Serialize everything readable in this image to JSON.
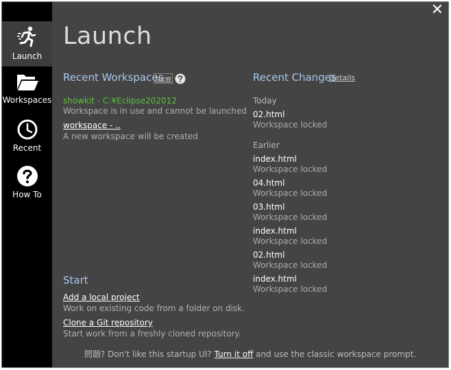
{
  "window": {
    "title": "Launch"
  },
  "sidebar": {
    "items": [
      {
        "label": "Launch",
        "icon": "running-person-icon"
      },
      {
        "label": "Workspaces",
        "icon": "folder-open-icon"
      },
      {
        "label": "Recent",
        "icon": "clock-icon"
      },
      {
        "label": "How To",
        "icon": "question-circle-icon"
      }
    ]
  },
  "recent_workspaces": {
    "heading": "Recent Workspaces",
    "new_label": "New",
    "items": [
      {
        "name": "showkit - C:¥Eclipse202012",
        "desc": "Workspace is in use and cannot be launched"
      },
      {
        "name": "workspace - ..",
        "desc": "A new workspace will be created"
      }
    ]
  },
  "recent_changes": {
    "heading": "Recent Changes",
    "details_label": "Details",
    "today_label": "Today",
    "earlier_label": "Earlier",
    "today": [
      {
        "file": "02.html",
        "status": "Workspace locked"
      }
    ],
    "earlier": [
      {
        "file": "index.html",
        "status": "Workspace locked"
      },
      {
        "file": "04.html",
        "status": "Workspace locked"
      },
      {
        "file": "03.html",
        "status": "Workspace locked"
      },
      {
        "file": "index.html",
        "status": "Workspace locked"
      },
      {
        "file": "02.html",
        "status": "Workspace locked"
      },
      {
        "file": "index.html",
        "status": "Workspace locked"
      }
    ]
  },
  "start": {
    "heading": "Start",
    "items": [
      {
        "label": "Add a local project",
        "desc": "Work on existing code from a folder on disk."
      },
      {
        "label": "Clone a Git repository",
        "desc": "Start work from a freshly cloned repository."
      }
    ]
  },
  "footer": {
    "prefix": "問題? Don't like this startup UI?",
    "link": "Turn it off",
    "suffix": "and use the classic workspace prompt."
  },
  "colors": {
    "background": "#444444",
    "sidebar": "#000000",
    "heading_blue": "#a8c8ec",
    "in_use_green": "#58c23c"
  }
}
